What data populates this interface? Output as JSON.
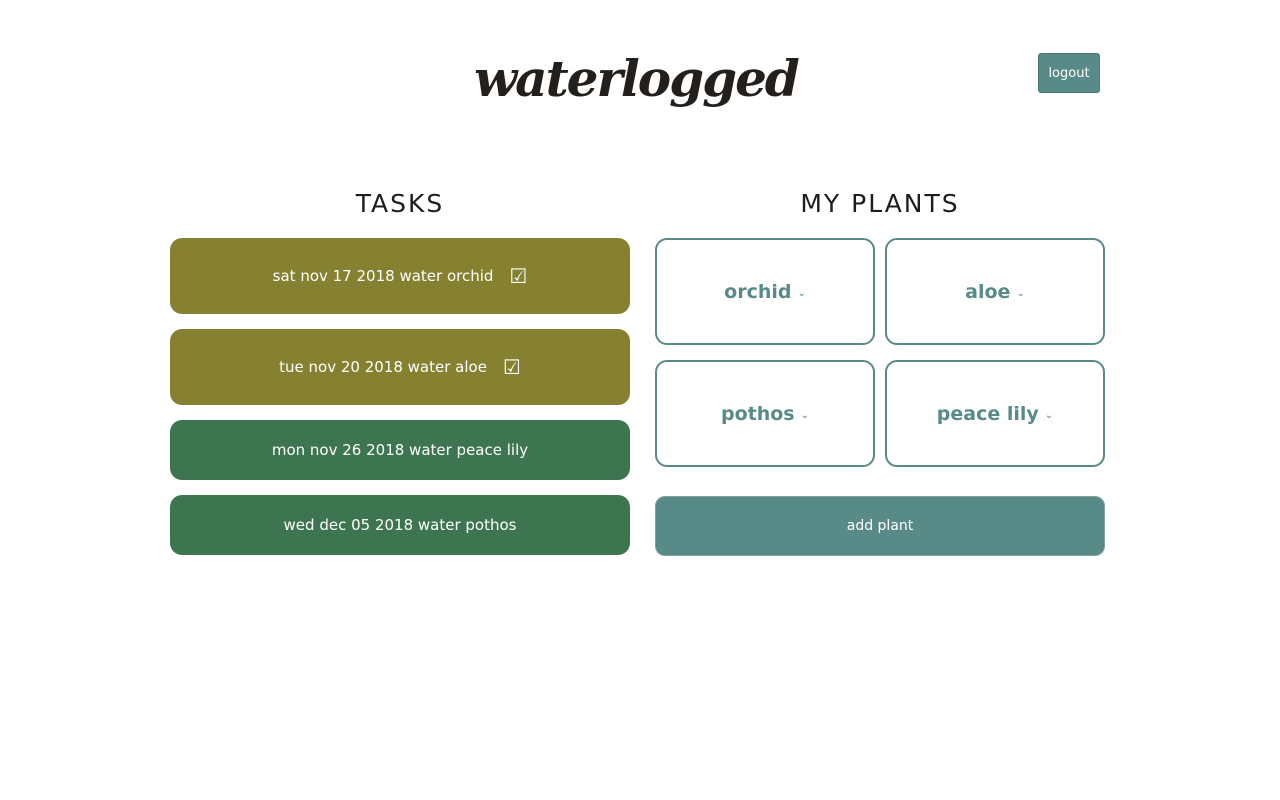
{
  "header": {
    "logo_text": "waterlogged",
    "logout_label": "logout"
  },
  "tasks": {
    "title": "TASKS",
    "items": [
      {
        "label": "sat nov 17 2018 water orchid",
        "check": "☑",
        "status": "done"
      },
      {
        "label": "tue nov 20 2018 water aloe",
        "check": "☑",
        "status": "done"
      },
      {
        "label": "mon nov 26 2018 water peace lily",
        "status": "pending"
      },
      {
        "label": "wed dec 05 2018 water pothos",
        "status": "pending"
      }
    ]
  },
  "plants": {
    "title": "MY PLANTS",
    "items": [
      {
        "name": "orchid",
        "chevron": "⌄"
      },
      {
        "name": "aloe",
        "chevron": "⌄"
      },
      {
        "name": "pothos",
        "chevron": "⌄"
      },
      {
        "name": "peace lily",
        "chevron": "⌄"
      }
    ],
    "add_label": "add plant"
  },
  "colors": {
    "done_task": "#858130",
    "pending_task": "#3d7550",
    "accent": "#588b88",
    "text_dark": "#1d1d1d"
  },
  "icons": {
    "check": "checkbox-checked-icon",
    "chevron": "chevron-down-icon"
  }
}
